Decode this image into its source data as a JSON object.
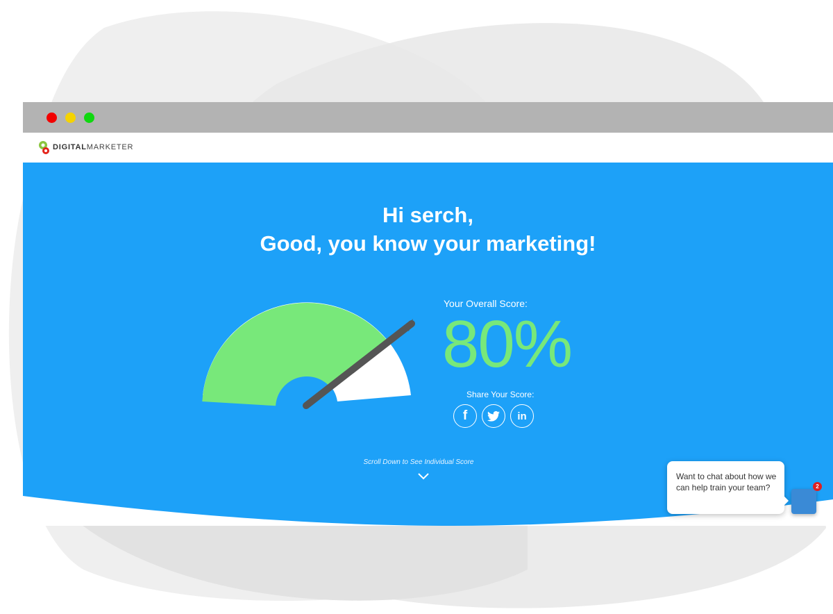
{
  "window": {
    "controls": [
      "close",
      "minimize",
      "maximize"
    ]
  },
  "navbar": {
    "logo_bold": "DIGITAL",
    "logo_light": "MARKETER"
  },
  "hero": {
    "greeting_line1": "Hi serch,",
    "greeting_line2": "Good, you know your marketing!",
    "score_label": "Your Overall Score:",
    "score_value": "80%",
    "score_fraction": 0.8,
    "share_label": "Share Your Score:",
    "share_icons": [
      "facebook-icon",
      "twitter-icon",
      "linkedin-icon"
    ],
    "facebook_glyph": "f",
    "linkedin_glyph": "in",
    "scroll_text": "Scroll Down to See Individual Score"
  },
  "chat": {
    "message": "Want to chat about how we can help train your team?",
    "badge_count": "2"
  },
  "colors": {
    "hero_bg": "#1da1f8",
    "gauge_fill": "#78e87a",
    "score_text": "#78e87a",
    "titlebar": "#b3b3b3",
    "chat_button": "#3a8ad6"
  }
}
